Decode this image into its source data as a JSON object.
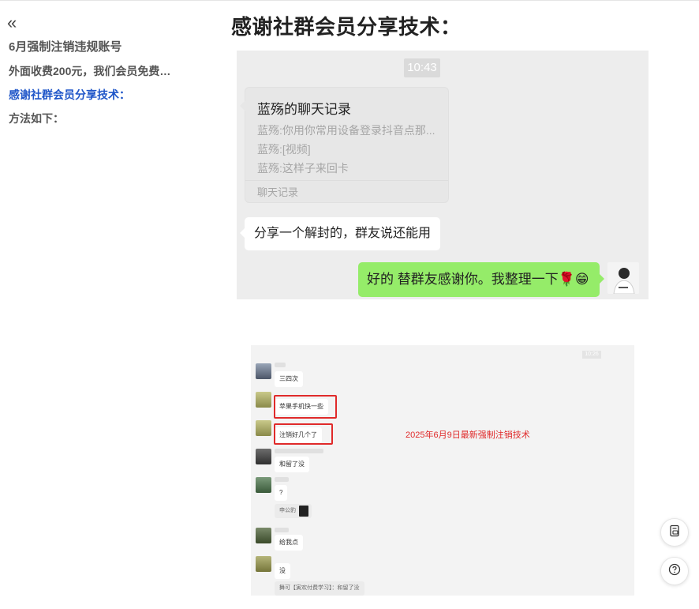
{
  "sidebar": {
    "collapse_glyph": "«",
    "items": [
      {
        "label": "6月强制注销违规账号",
        "active": false
      },
      {
        "label": "外面收费200元，我们会员免费…",
        "active": false
      },
      {
        "label": "感谢社群会员分享技术：",
        "active": true
      },
      {
        "label": "方法如下：",
        "active": false
      }
    ]
  },
  "article": {
    "title": "感谢社群会员分享技术："
  },
  "chat1": {
    "time": "10:43",
    "record": {
      "title": "蓝殇的聊天记录",
      "lines": [
        "蓝殇:你用你常用设备登录抖音点那...",
        "蓝殇:[视频]",
        "蓝殇:这样子来回卡"
      ],
      "footer": "聊天记录"
    },
    "incoming": "分享一个解封的，群友说还能用",
    "outgoing": "好的 替群友感谢你。我整理一下🌹😁"
  },
  "chat2": {
    "timestamp": "10:26",
    "messages": [
      "三四次",
      "苹果手机快一些",
      "注销好几个了",
      "和留了没",
      "?",
      "申公豹",
      "给我点",
      "没",
      "舞可【寅欢付费学习】：和留了没"
    ],
    "annotation": "2025年6月9日最新强制注销技术"
  },
  "colors": {
    "accent": "#1e55c8",
    "wechat_green": "#95ec69",
    "highlight_red": "#e02a2a"
  },
  "icons": {
    "collapse": "double-chevron-left-icon",
    "feedback": "feedback-icon",
    "help": "help-icon"
  }
}
